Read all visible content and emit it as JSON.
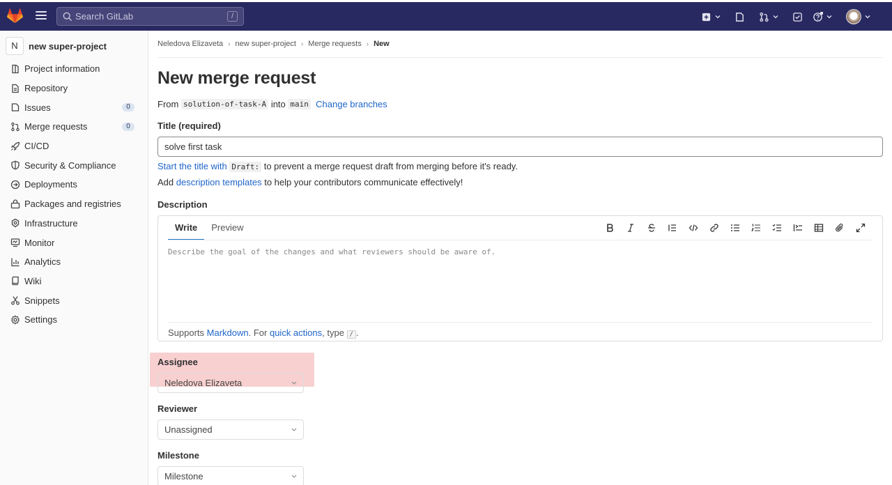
{
  "topbar": {
    "search_placeholder": "Search GitLab",
    "search_shortcut": "/",
    "icons": [
      "gitlab-logo-icon",
      "menu-icon",
      "search-icon",
      "new-item-icon",
      "issues-icon",
      "merge-requests-icon",
      "todos-icon",
      "help-icon",
      "avatar"
    ],
    "color": "#292961"
  },
  "sidebar": {
    "project_initial": "N",
    "project_name": "new super-project",
    "items": [
      {
        "label": "Project information",
        "icon": "info-icon"
      },
      {
        "label": "Repository",
        "icon": "document-icon"
      },
      {
        "label": "Issues",
        "icon": "issues-icon",
        "badge": "0"
      },
      {
        "label": "Merge requests",
        "icon": "merge-request-icon",
        "badge": "0"
      },
      {
        "label": "CI/CD",
        "icon": "rocket-icon"
      },
      {
        "label": "Security & Compliance",
        "icon": "shield-icon"
      },
      {
        "label": "Deployments",
        "icon": "deployments-icon"
      },
      {
        "label": "Packages and registries",
        "icon": "package-icon"
      },
      {
        "label": "Infrastructure",
        "icon": "cloud-gear-icon"
      },
      {
        "label": "Monitor",
        "icon": "monitor-icon"
      },
      {
        "label": "Analytics",
        "icon": "chart-icon"
      },
      {
        "label": "Wiki",
        "icon": "book-icon"
      },
      {
        "label": "Snippets",
        "icon": "scissors-icon"
      },
      {
        "label": "Settings",
        "icon": "gear-icon"
      }
    ]
  },
  "breadcrumb": {
    "items": [
      "Neledova Elizaveta",
      "new super-project",
      "Merge requests"
    ],
    "current": "New"
  },
  "page": {
    "title": "New merge request",
    "from_label": "From",
    "source_branch": "solution-of-task-A",
    "into_label": "into",
    "target_branch": "main",
    "change_branches": "Change branches"
  },
  "form": {
    "title_label": "Title (required)",
    "title_value": "solve first task",
    "hint_link": "Start the title with",
    "hint_code": "Draft:",
    "hint_rest": " to prevent a merge request draft from merging before it's ready.",
    "templates_prefix": "Add ",
    "templates_link": "description templates",
    "templates_rest": " to help your contributors communicate effectively!",
    "description_label": "Description",
    "tab_write": "Write",
    "tab_preview": "Preview",
    "toolbar_icons": [
      "bold-icon",
      "italic-icon",
      "strikethrough-icon",
      "quote-icon",
      "code-icon",
      "link-icon",
      "bullet-list-icon",
      "numbered-list-icon",
      "task-list-icon",
      "collapsible-icon",
      "table-icon",
      "attach-icon",
      "fullscreen-icon"
    ],
    "description_placeholder": "Describe the goal of the changes and what reviewers should be aware of.",
    "supports_prefix": "Supports ",
    "markdown_link": "Markdown",
    "for_text": ". For ",
    "quick_actions_link": "quick actions",
    "type_text": ", type ",
    "slash_key": "/",
    "end_period": ".",
    "assignee_label": "Assignee",
    "assignee_value": "Neledova Elizaveta",
    "reviewer_label": "Reviewer",
    "reviewer_value": "Unassigned",
    "milestone_label": "Milestone",
    "milestone_value": "Milestone",
    "highlight_color": "#f09696"
  }
}
